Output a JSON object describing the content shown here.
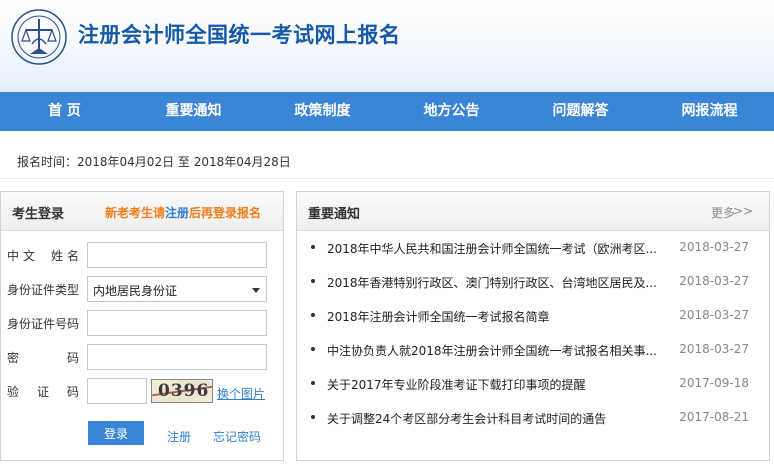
{
  "header": {
    "title": "注册会计师全国统一考试网上报名"
  },
  "nav": [
    "首 页",
    "重要通知",
    "政策制度",
    "地方公告",
    "问题解答",
    "网报流程"
  ],
  "registration": {
    "time_text": "报名时间：2018年04月02日 至 2018年04月28日"
  },
  "login": {
    "title": "考生登录",
    "hint_prefix": "新老考生请",
    "hint_link": "注册",
    "hint_suffix": "后再登录报名",
    "name_label": [
      "中",
      "文",
      "姓",
      "名"
    ],
    "id_type_label": "身份证件类型",
    "id_type_value": "内地居民身份证",
    "id_number_label": "身份证件号码",
    "password_label": [
      "密",
      "码"
    ],
    "captcha_label": [
      "验",
      "证",
      "码"
    ],
    "captcha_code": "0396",
    "refresh_label": "换个图片",
    "login_button": "登录",
    "register_link": "注册",
    "forgot_link": "忘记密码"
  },
  "notices": {
    "title": "重要通知",
    "more_label": "更多",
    "more_icon": ">>",
    "items": [
      {
        "title": "2018年中华人民共和国注册会计师全国统一考试（欧洲考区...",
        "date": "2018-03-27"
      },
      {
        "title": "2018年香港特别行政区、澳门特别行政区、台湾地区居民及...",
        "date": "2018-03-27"
      },
      {
        "title": "2018年注册会计师全国统一考试报名简章",
        "date": "2018-03-27"
      },
      {
        "title": "中注协负责人就2018年注册会计师全国统一考试报名相关事...",
        "date": "2018-03-27"
      },
      {
        "title": "关于2017年专业阶段准考证下载打印事项的提醒",
        "date": "2017-09-18"
      },
      {
        "title": "关于调整24个考区部分考生会计科目考试时间的通告",
        "date": "2017-08-21"
      }
    ]
  }
}
